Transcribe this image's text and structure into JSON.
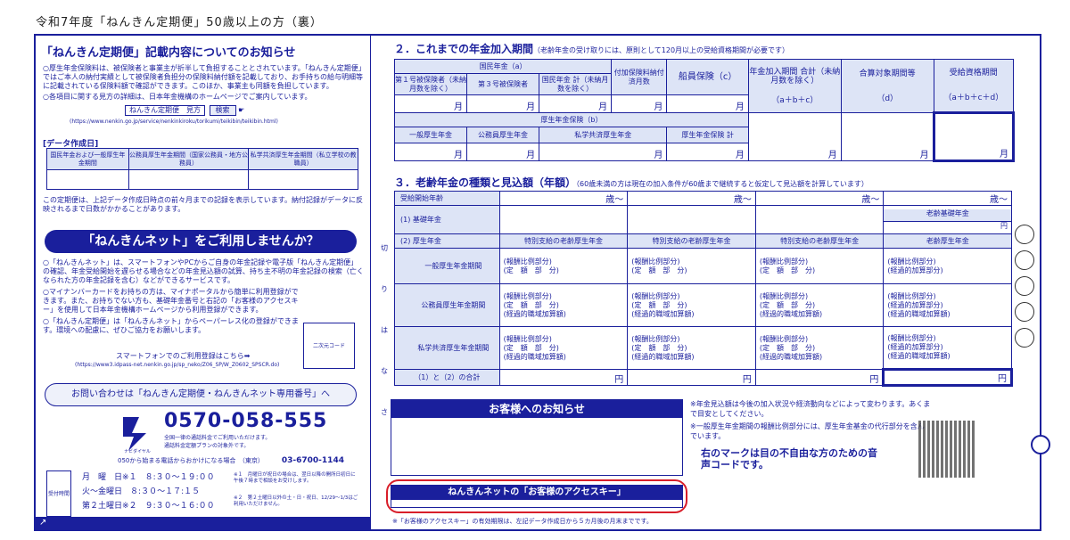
{
  "page_title": "令和7年度「ねんきん定期便」50歳以上の方（裏）",
  "left": {
    "title": "「ねんきん定期便」記載内容についてのお知らせ",
    "bullet1": "○厚生年金保険料は、被保険者と事業主が折半して負担することとされています。「ねんきん定期便」ではご本人の納付実績として被保険者負担分の保険料納付額を記載しており、お手持ちの給与明細等に記載されている保険料額で確認ができます。このほか、事業主も同額を負担しています。",
    "bullet2": "○各項目に関する見方の詳細は、日本年金機構のホームページでご案内しています。",
    "search_label": "ねんきん定期便　見方",
    "search_button": "検索",
    "url": "(https://www.nenkin.go.jp/service/nenkinkiroku/torikumi/teikibin/teikibin.html)",
    "data_label": "[データ作成日]",
    "data_cols": [
      "国民年金および一般厚生年金期間",
      "公務員厚生年金期間（国家公務員・地方公務員）",
      "私学共済厚生年金期間（私立学校の教職員）"
    ],
    "data_note": "この定期便は、上記データ作成日時点の前々月までの記録を表示しています。納付記録がデータに反映されるまで日数がかかることがあります。",
    "banner": "「ねんきんネット」をご利用しませんか？",
    "net1": "○「ねんきんネット」は、スマートフォンやPCからご自身の年金記録や電子版「ねんきん定期便」の確認、年金受給開始を遅らせる場合などの年金見込額の試算、持ち主不明の年金記録の検索（亡くなられた方の年金記録を含む）などができるサービスです。",
    "net2": "○マイナンバーカードをお持ちの方は、マイナポータルから簡単に利用登録ができます。また、お持ちでない方も、基礎年金番号と右記の「お客様のアクセスキー」を使用して日本年金機構ホームページから利用登録ができます。",
    "net3": "○「ねんきん定期便」は「ねんきんネット」からペーパーレス化の登録ができます。環境への配慮に、ぜひご協力をお願いします。",
    "qr_label": "二次元コード",
    "smartphone": "スマートフォンでのご利用登録はこちら➡",
    "smart_url": "(https://www3.idpass-net.nenkin.go.jp/sp_neko/Z06_SP/W_Z0602_SPSCR.do)",
    "inquiry": "お問い合わせは「ねんきん定期便・ねんきんネット専用番号」へ",
    "navi": "ナビダイヤル",
    "phone": "0570-058-555",
    "phone_note1": "全国一律の通話料金でご利用いただけます。",
    "phone_note2": "通話料金定額プランの対象外です。",
    "phone2_label": "050から始まる電話からおかけになる場合　（東京）",
    "phone2": "03-6700-1144",
    "hours_label": "受付時間",
    "hours": [
      {
        "day": "月　曜　日※１",
        "time": "８:３０～１９:００"
      },
      {
        "day": "火～金曜日",
        "time": "８:３０～１７:１５"
      },
      {
        "day": "第２土曜日※２",
        "time": "９:３０～１６:００"
      }
    ],
    "hours_note1": "※１　月曜日が祝日の場合は、翌日以降の開所日初日に午後７時まで相談をお受けします。",
    "hours_note2": "※２　第２土曜日以外の土・日・祝日、12/29～1/3はご利用いただけません。"
  },
  "sec2": {
    "title": "２．これまでの年金加入期間",
    "sub": "（老齢年金の受け取りには、原則として120月以上の受給資格期間が必要です）",
    "kokumin": "国民年金（a）",
    "k1": "第１号被保険者（未納月数を除く）",
    "k3": "第３号被保険者",
    "ksum": "国民年金 計（未納月数を除く）",
    "fuka": "付加保険料納付済月数",
    "senin": "船員保険（c）",
    "total": "年金加入期間 合計（未納月数を除く）",
    "total_f": "（a＋b＋c）",
    "gassan": "合算対象期間等",
    "gassan_f": "（d）",
    "jukyu": "受給資格期間",
    "jukyu_f": "（a＋b＋c＋d）",
    "kosei": "厚生年金保険（b）",
    "kosei_cols": [
      "一般厚生年金",
      "公務員厚生年金",
      "私学共済厚生年金",
      "厚生年金保険 計"
    ],
    "unit": "月"
  },
  "sec3": {
    "title": "３．老齢年金の種類と見込額（年額）",
    "sub": "（60歳未満の方は現在の加入条件が60歳まで継続すると仮定して見込額を計算しています）",
    "start_age": "受給開始年齢",
    "age": "歳～",
    "kiso": "(1) 基礎年金",
    "kosei": "(2) 厚生年金",
    "tokubetsu": "特別支給の老齢厚生年金",
    "rourei_kiso": "老齢基礎年金",
    "rourei_kosei": "老齢厚生年金",
    "ippan": "一般厚生年金期間",
    "komuin": "公務員厚生年金期間",
    "shigaku": "私学共済厚生年金期間",
    "r_hourei": "(報酬比例部分)",
    "r_teigaku": "(定　額　部　分)",
    "r_keika": "(経過的職域加算額)",
    "r_keika2": "(経過的加算部分)",
    "total": "（1）と（2）の合計",
    "yen": "円",
    "vertical": "切　り　は　な　さ"
  },
  "notice": {
    "title": "お客様へのお知らせ",
    "note1": "※年金見込額は今後の加入状況や経済動向などによって変わります。あくまで目安としてください。",
    "note2": "※一般厚生年金期間の報酬比例部分には、厚生年金基金の代行部分を含んでいます。",
    "voice": "右のマークは目の不自由な方のための音声コードです。",
    "access_title": "ねんきんネットの「お客様のアクセスキー」",
    "access_note": "※「お客様のアクセスキー」の有効期限は、左記データ作成日から５カ月後の月末までです。"
  }
}
